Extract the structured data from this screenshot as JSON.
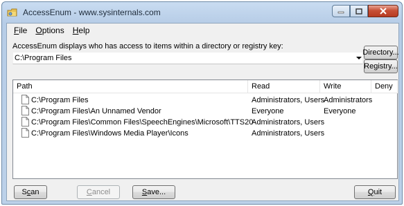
{
  "window": {
    "title": "AccessEnum - www.sysinternals.com"
  },
  "menu": [
    {
      "label": "File",
      "mnemonic": "F",
      "rest": "ile"
    },
    {
      "label": "Options",
      "mnemonic": "O",
      "rest": "ptions"
    },
    {
      "label": "Help",
      "mnemonic": "H",
      "rest": "elp"
    }
  ],
  "instruction": "AccessEnum displays who has access to items within a directory or registry key:",
  "path_combo": {
    "value": "C:\\Program Files"
  },
  "buttons": {
    "directory": "Directory...",
    "registry": "Registry...",
    "scan_mn": "c",
    "scan_pre": "S",
    "scan_post": "an",
    "cancel_mn": "C",
    "cancel_post": "ancel",
    "save_mn": "S",
    "save_post": "ave...",
    "quit_mn": "Q",
    "quit_post": "uit"
  },
  "table": {
    "columns": [
      "Path",
      "Read",
      "Write",
      "Deny"
    ],
    "rows": [
      {
        "path": "C:\\Program Files",
        "read": "Administrators, Users",
        "write": "Administrators",
        "deny": ""
      },
      {
        "path": "C:\\Program Files\\An Unnamed Vendor",
        "read": "Everyone",
        "write": "Everyone",
        "deny": ""
      },
      {
        "path": "C:\\Program Files\\Common Files\\SpeechEngines\\Microsoft\\TTS20",
        "read": "Administrators, Users",
        "write": "",
        "deny": ""
      },
      {
        "path": "C:\\Program Files\\Windows Media Player\\Icons",
        "read": "Administrators, Users",
        "write": "",
        "deny": ""
      }
    ]
  },
  "colors": {
    "title_bar": "#bcd1e9",
    "close_button": "#c75037",
    "client_bg": "#f0f0f0"
  }
}
